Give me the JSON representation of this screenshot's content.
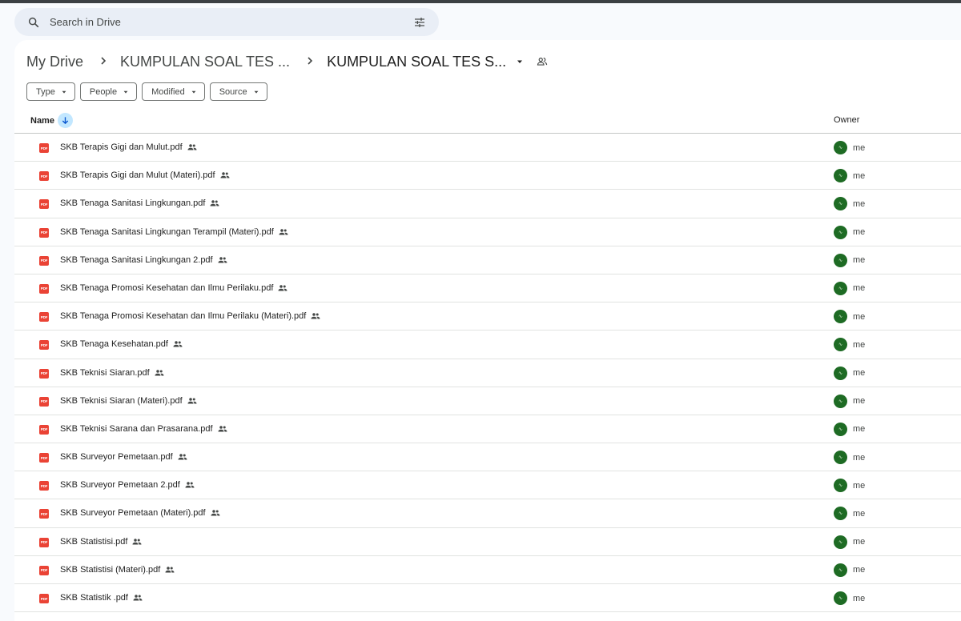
{
  "search": {
    "placeholder": "Search in Drive"
  },
  "breadcrumb": {
    "root": "My Drive",
    "parent": "KUMPULAN SOAL TES ...",
    "current": "KUMPULAN SOAL TES S..."
  },
  "filters": [
    "Type",
    "People",
    "Modified",
    "Source"
  ],
  "table": {
    "name_header": "Name",
    "owner_header": "Owner",
    "pdf_label": "PDF",
    "rows": [
      {
        "name": "SKB Terapis Gigi dan Mulut.pdf",
        "owner": "me"
      },
      {
        "name": "SKB Terapis Gigi dan Mulut (Materi).pdf",
        "owner": "me"
      },
      {
        "name": "SKB Tenaga Sanitasi Lingkungan.pdf",
        "owner": "me"
      },
      {
        "name": "SKB Tenaga Sanitasi Lingkungan Terampil (Materi).pdf",
        "owner": "me"
      },
      {
        "name": "SKB Tenaga Sanitasi Lingkungan 2.pdf",
        "owner": "me"
      },
      {
        "name": "SKB Tenaga Promosi Kesehatan dan Ilmu Perilaku.pdf",
        "owner": "me"
      },
      {
        "name": "SKB Tenaga Promosi Kesehatan dan Ilmu Perilaku (Materi).pdf",
        "owner": "me"
      },
      {
        "name": "SKB Tenaga Kesehatan.pdf",
        "owner": "me"
      },
      {
        "name": "SKB Teknisi Siaran.pdf",
        "owner": "me"
      },
      {
        "name": "SKB Teknisi Siaran (Materi).pdf",
        "owner": "me"
      },
      {
        "name": "SKB Teknisi Sarana dan Prasarana.pdf",
        "owner": "me"
      },
      {
        "name": "SKB Surveyor Pemetaan.pdf",
        "owner": "me"
      },
      {
        "name": "SKB Surveyor Pemetaan 2.pdf",
        "owner": "me"
      },
      {
        "name": "SKB Surveyor Pemetaan (Materi).pdf",
        "owner": "me"
      },
      {
        "name": "SKB Statistisi.pdf",
        "owner": "me"
      },
      {
        "name": "SKB Statistisi (Materi).pdf",
        "owner": "me"
      },
      {
        "name": "SKB Statistik .pdf",
        "owner": "me"
      }
    ]
  },
  "icons": [
    "search-icon",
    "tune-icon",
    "chevron-right-icon",
    "caret-down-icon",
    "shared-folder-icon",
    "sort-arrow-down-icon",
    "pdf-icon",
    "shared-people-icon",
    "owner-avatar"
  ],
  "colors": {
    "accent": "#c2e7ff",
    "pdf": "#ea4335",
    "avatar": "#1e6b24"
  }
}
